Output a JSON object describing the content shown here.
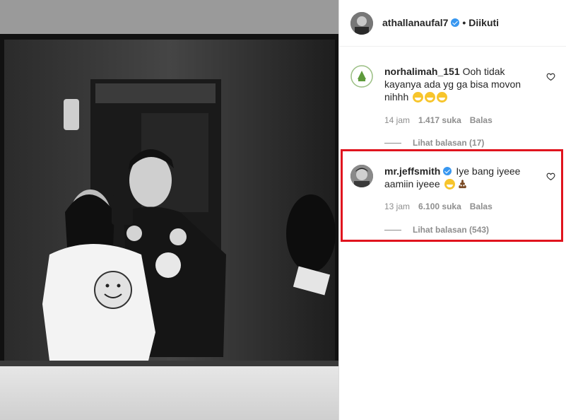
{
  "post": {
    "author": "athallanaufal7",
    "follow_status": "Diikuti",
    "separator": "•"
  },
  "comments": [
    {
      "username": "norhalimah_151",
      "text": "Ooh tidak kayanya ada yg ga bisa movon nihhh",
      "emojis": [
        "grinning-squinting-face",
        "grinning-squinting-face",
        "grinning-squinting-face"
      ],
      "time": "14 jam",
      "likes": "1.417 suka",
      "reply_label": "Balas",
      "view_replies": "Lihat balasan (17)",
      "verified": false
    },
    {
      "username": "mr.jeffsmith",
      "text": "Iye bang iyeee aamiin iyeee",
      "emojis": [
        "grinning-squinting-face",
        "pile-of-poo"
      ],
      "time": "13 jam",
      "likes": "6.100 suka",
      "reply_label": "Balas",
      "view_replies": "Lihat balasan (543)",
      "verified": true
    }
  ],
  "colors": {
    "highlight_border": "#e0141e",
    "verified_badge": "#3897f0",
    "muted_text": "#8e8e8e"
  }
}
